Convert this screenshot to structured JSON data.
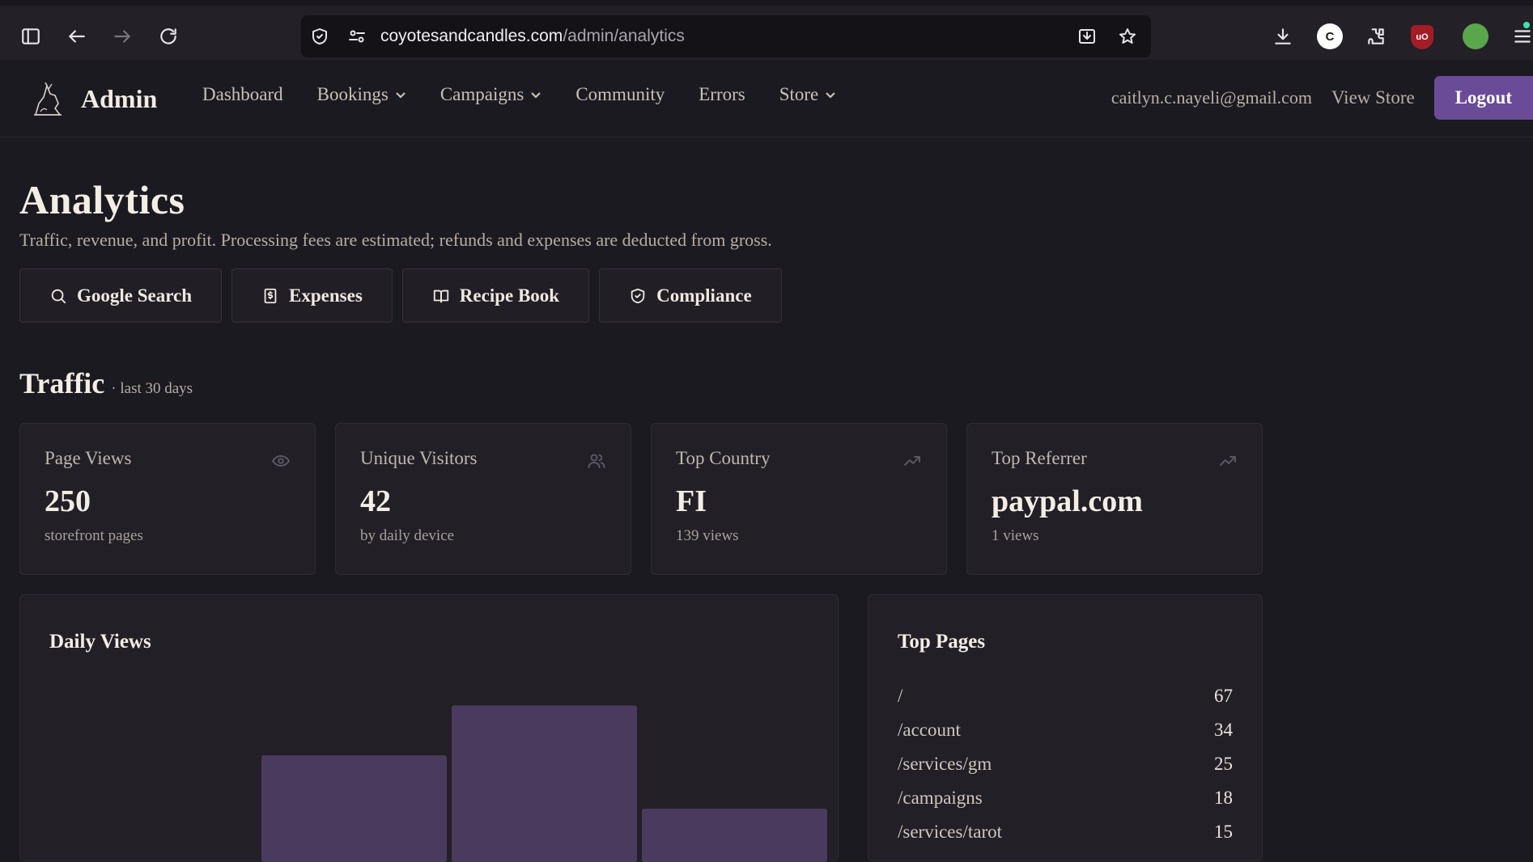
{
  "browser": {
    "url_host": "coyotesandcandles.com",
    "url_path": "/admin/analytics",
    "extensions": [
      {
        "name": "C",
        "bg": "#ffffff",
        "fg": "#1c1a21"
      },
      {
        "name": "uO",
        "bg": "#a31d25",
        "fg": "#ffffff"
      },
      {
        "name": "",
        "bg": "#5aa64c",
        "fg": "#ffffff"
      }
    ]
  },
  "nav": {
    "brand": "Admin",
    "links": [
      {
        "label": "Dashboard",
        "dropdown": false
      },
      {
        "label": "Bookings",
        "dropdown": true
      },
      {
        "label": "Campaigns",
        "dropdown": true
      },
      {
        "label": "Community",
        "dropdown": false
      },
      {
        "label": "Errors",
        "dropdown": false
      },
      {
        "label": "Store",
        "dropdown": true
      }
    ],
    "email": "caitlyn.c.nayeli@gmail.com",
    "view_store": "View Store",
    "logout": "Logout"
  },
  "page": {
    "title": "Analytics",
    "subtitle": "Traffic, revenue, and profit. Processing fees are estimated; refunds and expenses are deducted from gross.",
    "quick_links": [
      {
        "label": "Google Search",
        "icon": "search-icon"
      },
      {
        "label": "Expenses",
        "icon": "receipt-icon"
      },
      {
        "label": "Recipe Book",
        "icon": "book-icon"
      },
      {
        "label": "Compliance",
        "icon": "shield-icon"
      }
    ]
  },
  "traffic": {
    "title": "Traffic",
    "period": "· last 30 days",
    "stats": [
      {
        "label": "Page Views",
        "value": "250",
        "sub": "storefront pages",
        "icon": "eye-icon"
      },
      {
        "label": "Unique Visitors",
        "value": "42",
        "sub": "by daily device",
        "icon": "users-icon"
      },
      {
        "label": "Top Country",
        "value": "FI",
        "sub": "139 views",
        "icon": "trending-up-icon"
      },
      {
        "label": "Top Referrer",
        "value": "paypal.com",
        "sub": "1 views",
        "icon": "trending-up-icon"
      }
    ]
  },
  "daily_views": {
    "title": "Daily Views"
  },
  "chart_data": {
    "type": "bar",
    "title": "Daily Views",
    "categories": [
      "",
      "",
      "",
      ""
    ],
    "values": [
      0,
      60,
      88,
      30
    ],
    "ylim": [
      0,
      100
    ],
    "xlabel": "",
    "ylabel": "",
    "grid": false,
    "bar_color": "#4a3a5e"
  },
  "top_pages": {
    "title": "Top Pages",
    "rows": [
      {
        "path": "/",
        "count": "67"
      },
      {
        "path": "/account",
        "count": "34"
      },
      {
        "path": "/services/gm",
        "count": "25"
      },
      {
        "path": "/campaigns",
        "count": "18"
      },
      {
        "path": "/services/tarot",
        "count": "15"
      }
    ]
  }
}
